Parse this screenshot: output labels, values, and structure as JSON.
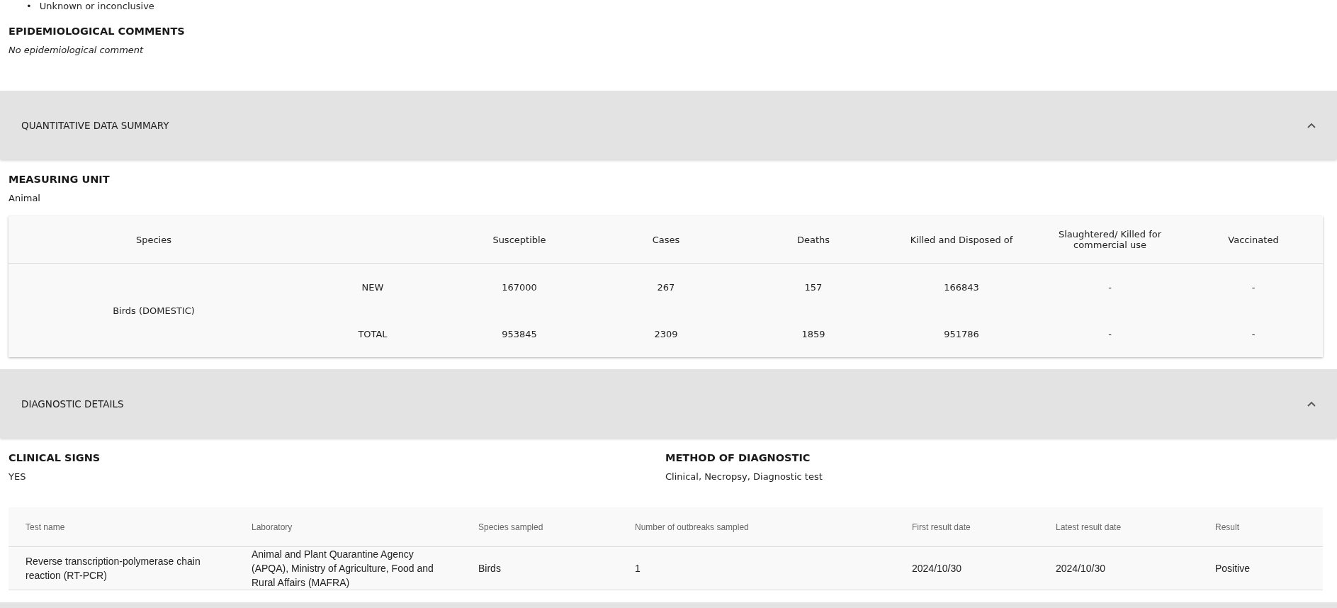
{
  "outcome_list": [
    {
      "marker": "•",
      "text": "Unknown or inconclusive"
    }
  ],
  "epidemiological_comments": {
    "heading": "EPIDEMIOLOGICAL COMMENTS",
    "text": "No epidemiological comment"
  },
  "quantitative_section": {
    "title": "QUANTITATIVE DATA SUMMARY",
    "expanded": true,
    "measuring_unit": {
      "heading": "MEASURING UNIT",
      "value": "Animal"
    },
    "table": {
      "species_column": "Species",
      "value_columns": [
        "Susceptible",
        "Cases",
        "Deaths",
        "Killed and Disposed of",
        "Slaughtered/ Killed for commercial use",
        "Vaccinated"
      ],
      "rows": [
        {
          "species": "Birds (DOMESTIC)",
          "lines": [
            {
              "label": "NEW",
              "values": [
                "167000",
                "267",
                "157",
                "166843",
                "-",
                "-"
              ]
            },
            {
              "label": "TOTAL",
              "values": [
                "953845",
                "2309",
                "1859",
                "951786",
                "-",
                "-"
              ]
            }
          ]
        }
      ]
    }
  },
  "diagnostic_section": {
    "title": "DIAGNOSTIC DETAILS",
    "expanded": true,
    "clinical_signs": {
      "heading": "CLINICAL SIGNS",
      "value": "YES"
    },
    "method": {
      "heading": "METHOD OF DIAGNOSTIC",
      "value": "Clinical, Necropsy, Diagnostic test"
    },
    "table": {
      "columns": [
        "Test name",
        "Laboratory",
        "Species sampled",
        "Number of outbreaks sampled",
        "First result date",
        "Latest result date",
        "Result"
      ],
      "rows": [
        [
          "Reverse transcription-polymerase chain reaction (RT-PCR)",
          "Animal and Plant Quarantine Agency (APQA), Ministry of Agriculture, Food and Rural Affairs (MAFRA)",
          "Birds",
          "1",
          "2024/10/30",
          "2024/10/30",
          "Positive"
        ]
      ]
    }
  }
}
